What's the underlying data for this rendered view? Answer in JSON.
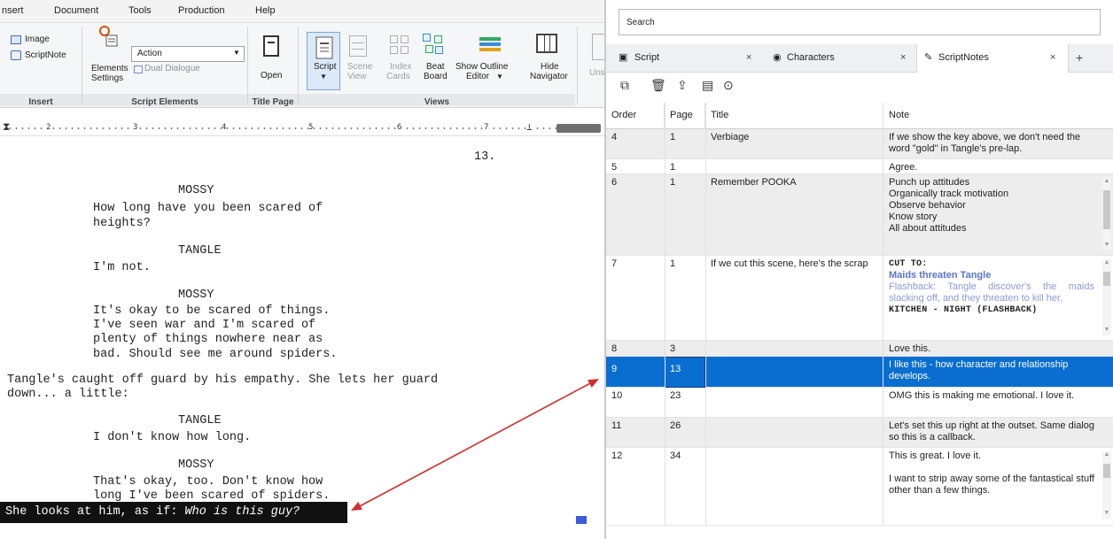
{
  "menu": {
    "items": [
      "nsert",
      "Document",
      "Tools",
      "Production",
      "Help"
    ]
  },
  "ribbon": {
    "insert_group": {
      "image_label": "Image",
      "scriptnote_label": "ScriptNote",
      "group_label": "Insert"
    },
    "elements_group": {
      "settings_label_1": "Elements",
      "settings_label_2": "Settings",
      "element_select_value": "Action",
      "dual_dialogue_label": "Dual Dialogue",
      "group_label": "Script Elements"
    },
    "title_page_group": {
      "open_label": "Open",
      "group_label": "Title Page"
    },
    "views_group": {
      "script_label": "Script",
      "scene_view_label_1": "Scene",
      "scene_view_label_2": "View",
      "index_cards_label_1": "Index",
      "index_cards_label_2": "Cards",
      "beat_board_label_1": "Beat",
      "beat_board_label_2": "Board",
      "show_outline_label_1": "Show Outline",
      "show_outline_label_2": "Editor",
      "hide_navigator_label_1": "Hide",
      "hide_navigator_label_2": "Navigator",
      "group_label": "Views",
      "cut_label": "Uns"
    }
  },
  "ruler": {
    "numbers": [
      "2",
      "3",
      "4",
      "5",
      "6",
      "7"
    ]
  },
  "script": {
    "page_number": "13.",
    "lines": [
      {
        "text": "MOSSY",
        "indent": "character"
      },
      {
        "text": "How long have you been scared of",
        "indent": "dialogue"
      },
      {
        "text": "heights?",
        "indent": "dialogue"
      },
      {
        "text": "TANGLE",
        "indent": "character"
      },
      {
        "text": "I'm not.",
        "indent": "dialogue"
      },
      {
        "text": "MOSSY",
        "indent": "character"
      },
      {
        "text": "It's okay to be scared of things.",
        "indent": "dialogue"
      },
      {
        "text": "I've seen war and I'm scared of",
        "indent": "dialogue"
      },
      {
        "text": "plenty of things nowhere near as",
        "indent": "dialogue"
      },
      {
        "text": "bad. Should see me around spiders.",
        "indent": "dialogue"
      },
      {
        "text": "Tangle's caught off guard by his empathy. She lets her guard",
        "indent": "action"
      },
      {
        "text": "down... a little:",
        "indent": "action"
      },
      {
        "text": "TANGLE",
        "indent": "character"
      },
      {
        "text": "I don't know how long.",
        "indent": "dialogue"
      },
      {
        "text": "MOSSY",
        "indent": "character"
      },
      {
        "text": "That's okay, too. Don't know how",
        "indent": "dialogue"
      },
      {
        "text": "long I've been scared of spiders.",
        "indent": "dialogue"
      }
    ],
    "highlighted_action_prefix": "She looks at him, as if: ",
    "highlighted_action_italic": "Who is this guy?"
  },
  "panel": {
    "search_placeholder": "Search",
    "tabs": [
      {
        "label": "Script",
        "icon": "script-icon"
      },
      {
        "label": "Characters",
        "icon": "characters-icon"
      },
      {
        "label": "ScriptNotes",
        "icon": "scriptnotes-icon"
      }
    ],
    "tab_close": "×",
    "tab_add": "+",
    "columns": [
      "Order",
      "Page",
      "Title",
      "Note"
    ],
    "rows": [
      {
        "order": "4",
        "page": "1",
        "title": "Verbiage",
        "note": "If we show the key above, we don't need the word \"gold\" in Tangle's pre-lap."
      },
      {
        "order": "5",
        "page": "1",
        "title": "",
        "note": "Agree."
      },
      {
        "order": "6",
        "page": "1",
        "title": "Remember POOKA",
        "note_lines": [
          "Punch up attitudes",
          "Organically track motivation",
          "Observe behavior",
          "Know story",
          "All about attitudes"
        ]
      },
      {
        "order": "7",
        "page": "1",
        "title": "If we cut this scene, here's the scrap",
        "note_parts": {
          "transition": "CUT TO:",
          "heading": "Maids threaten Tangle",
          "description": "Flashback: Tangle discover's the maids slacking off, and they threaten to kill her.",
          "slug": "KITCHEN - NIGHT (FLASHBACK)"
        }
      },
      {
        "order": "8",
        "page": "3",
        "title": "",
        "note": "Love this."
      },
      {
        "order": "9",
        "page": "13",
        "title": "",
        "note": "I like this - how character and relationship develops."
      },
      {
        "order": "10",
        "page": "23",
        "title": "",
        "note": "OMG this is making me emotional. I love it."
      },
      {
        "order": "11",
        "page": "26",
        "title": "",
        "note": "Let's set this up right at the outset. Same dialog so this is a callback."
      },
      {
        "order": "12",
        "page": "34",
        "title": "",
        "note_lines": [
          "This is great. I love it.",
          "",
          "I want to strip away some of the fantastical stuff other than a few things."
        ]
      }
    ]
  },
  "colors": {
    "selection": "#0a6ed1",
    "arrow": "#d32f2f",
    "highlight_bg": "#111111",
    "note_heading": "#5b74c9",
    "note_description": "#8c9ad8"
  }
}
